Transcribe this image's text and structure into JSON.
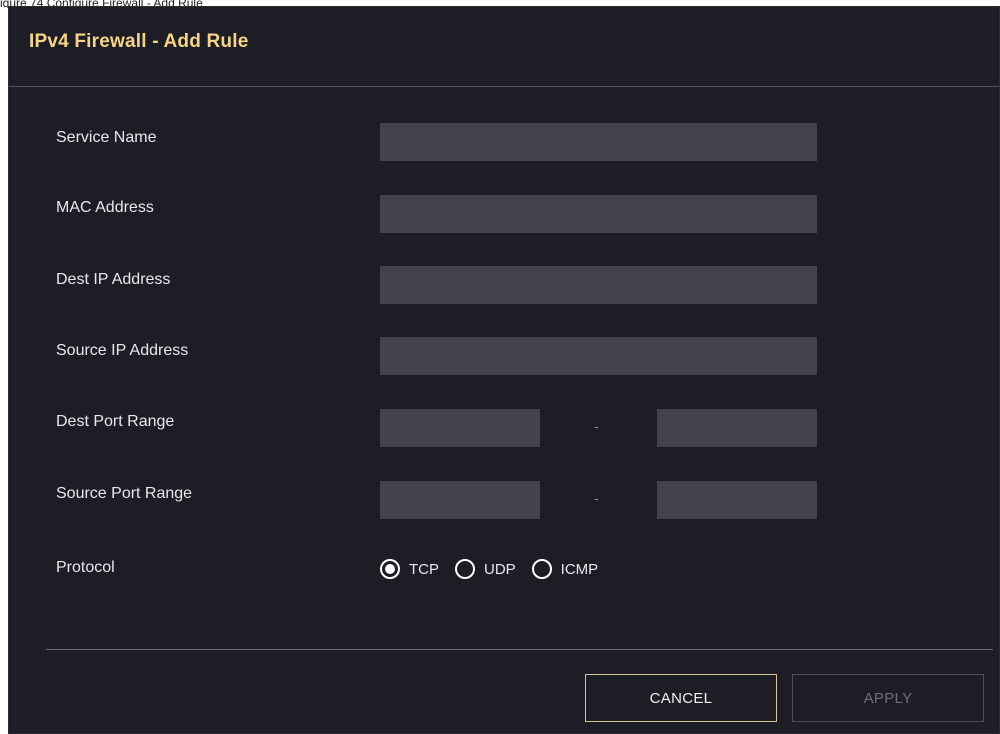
{
  "caption": "igure 74   Configure Firewall - Add Rule",
  "dialog": {
    "title": "IPv4 Firewall - Add Rule"
  },
  "form": {
    "service_name": {
      "label": "Service Name",
      "value": ""
    },
    "mac_address": {
      "label": "MAC Address",
      "value": ""
    },
    "dest_ip": {
      "label": "Dest IP Address",
      "value": ""
    },
    "source_ip": {
      "label": "Source IP Address",
      "value": ""
    },
    "dest_port_range": {
      "label": "Dest Port Range",
      "from": "",
      "to": "",
      "separator": "-"
    },
    "source_port_range": {
      "label": "Source Port Range",
      "from": "",
      "to": "",
      "separator": "-"
    },
    "protocol": {
      "label": "Protocol",
      "options": [
        "TCP",
        "UDP",
        "ICMP"
      ],
      "selected": "TCP"
    }
  },
  "buttons": {
    "cancel": "CANCEL",
    "apply": "APPLY"
  },
  "colors": {
    "dialog_bg": "#1d1d25",
    "field_bg": "#43434f",
    "title": "#f5d48a",
    "cancel_border": "#d9c493"
  }
}
